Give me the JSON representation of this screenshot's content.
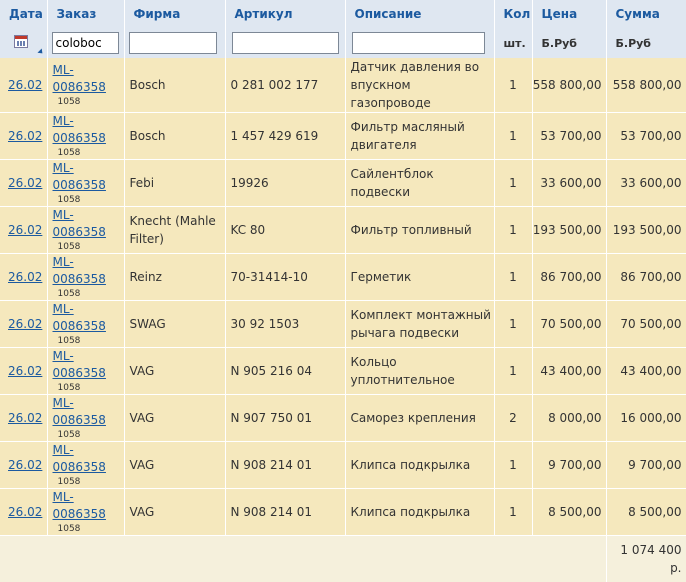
{
  "columns": [
    {
      "key": "date",
      "label": "Дата"
    },
    {
      "key": "order",
      "label": "Заказ"
    },
    {
      "key": "firm",
      "label": "Фирма"
    },
    {
      "key": "article",
      "label": "Артикул"
    },
    {
      "key": "desc",
      "label": "Описание"
    },
    {
      "key": "qty",
      "label": "Кол"
    },
    {
      "key": "price",
      "label": "Цена"
    },
    {
      "key": "sum",
      "label": "Сумма"
    }
  ],
  "filters": {
    "order_value": "coloboc",
    "firm_value": "",
    "article_value": "",
    "desc_value": "",
    "qty_unit": "шт.",
    "price_unit": "Б.Руб",
    "sum_unit": "Б.Руб"
  },
  "rows": [
    {
      "date": "26.02",
      "order": "ML-0086358",
      "order_sub": "1058",
      "firm": "Bosch",
      "article": "0 281 002 177",
      "desc": "Датчик давления во впускном газопроводе",
      "qty": "1",
      "price": "558 800,00",
      "sum": "558 800,00"
    },
    {
      "date": "26.02",
      "order": "ML-0086358",
      "order_sub": "1058",
      "firm": "Bosch",
      "article": "1 457 429 619",
      "desc": "Фильтр масляный двигателя",
      "qty": "1",
      "price": "53 700,00",
      "sum": "53 700,00"
    },
    {
      "date": "26.02",
      "order": "ML-0086358",
      "order_sub": "1058",
      "firm": "Febi",
      "article": "19926",
      "desc": "Сайлентблок подвески",
      "qty": "1",
      "price": "33 600,00",
      "sum": "33 600,00"
    },
    {
      "date": "26.02",
      "order": "ML-0086358",
      "order_sub": "1058",
      "firm": "Knecht (Mahle Filter)",
      "article": "KC 80",
      "desc": "Фильтр топливный",
      "qty": "1",
      "price": "193 500,00",
      "sum": "193 500,00"
    },
    {
      "date": "26.02",
      "order": "ML-0086358",
      "order_sub": "1058",
      "firm": "Reinz",
      "article": "70-31414-10",
      "desc": "Герметик",
      "qty": "1",
      "price": "86 700,00",
      "sum": "86 700,00"
    },
    {
      "date": "26.02",
      "order": "ML-0086358",
      "order_sub": "1058",
      "firm": "SWAG",
      "article": "30 92 1503",
      "desc": "Комплект монтажный рычага подвески",
      "qty": "1",
      "price": "70 500,00",
      "sum": "70 500,00"
    },
    {
      "date": "26.02",
      "order": "ML-0086358",
      "order_sub": "1058",
      "firm": "VAG",
      "article": "N 905 216 04",
      "desc": "Кольцо уплотнительное",
      "qty": "1",
      "price": "43 400,00",
      "sum": "43 400,00"
    },
    {
      "date": "26.02",
      "order": "ML-0086358",
      "order_sub": "1058",
      "firm": "VAG",
      "article": "N 907 750 01",
      "desc": "Саморез крепления",
      "qty": "2",
      "price": "8 000,00",
      "sum": "16 000,00"
    },
    {
      "date": "26.02",
      "order": "ML-0086358",
      "order_sub": "1058",
      "firm": "VAG",
      "article": "N 908 214 01",
      "desc": "Клипса подкрылка",
      "qty": "1",
      "price": "9 700,00",
      "sum": "9 700,00"
    },
    {
      "date": "26.02",
      "order": "ML-0086358",
      "order_sub": "1058",
      "firm": "VAG",
      "article": "N 908 214 01",
      "desc": "Клипса подкрылка",
      "qty": "1",
      "price": "8 500,00",
      "sum": "8 500,00"
    }
  ],
  "total": {
    "value": "1 074 400",
    "unit": "р."
  },
  "icons": {
    "calendar": "calendar-icon",
    "sort": "sort-arrow-icon"
  },
  "colors": {
    "header_bg": "#dfe7f1",
    "row_bg": "#f5e8bd",
    "link": "#1c5aa0"
  }
}
